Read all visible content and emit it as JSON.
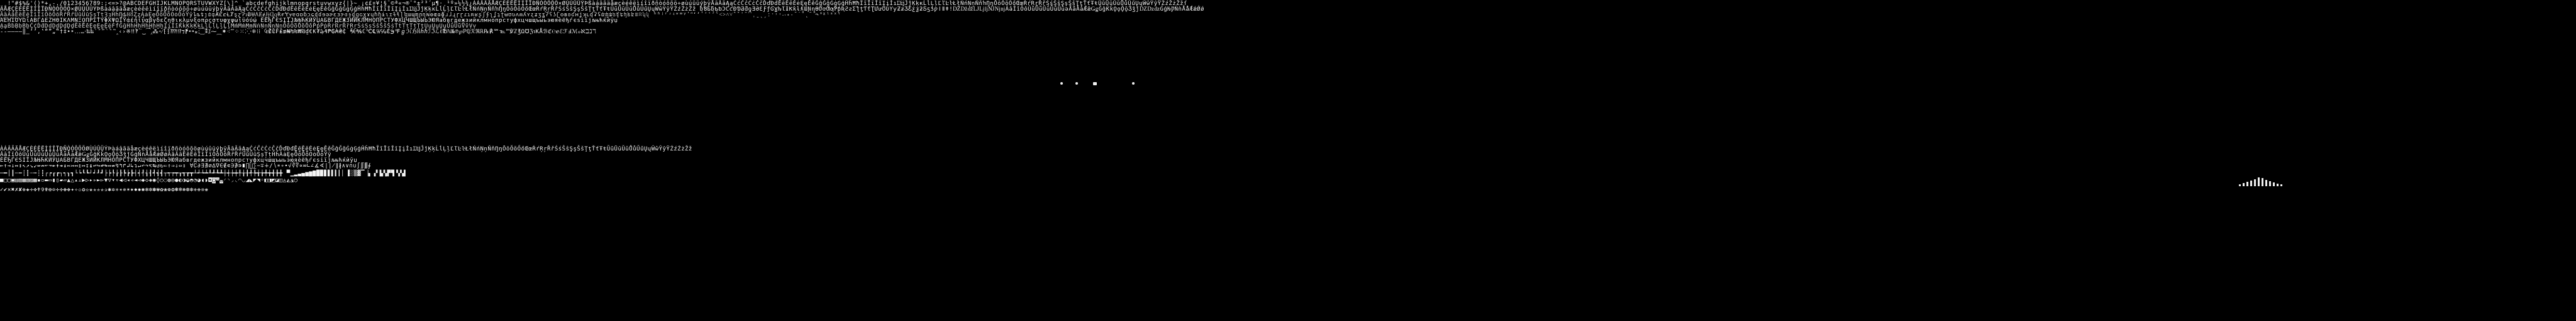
{
  "sheet": {
    "background": "#000000",
    "glyph_color": "#f4f4f4"
  },
  "top_rows": {
    "row1": "  !\"#$%&'()*+,-./0123456789:;<=>?@ABCDEFGHIJKLMNOPQRSTUVWXYZ[\\]^_`abcdefghijklmnopqrstuvwxyz{|}~ ¡¢£¤¥¦§¨©ª«¬®¯°±²³´µ¶·¸¹º»¼½¾¿ÀÁÂÃÄÅÆÇÈÉÊËÌÍÎÏÐÑÒÓÔÕÖ×ØÙÚÛÜÝÞßàáâãäåæçèéêëìíîïðñòóôõö÷øùúûüýþÿĀāĂăĄąĆćĈĉĊċČčĎďĐđĒēĔĕĖėĘęĚěĜĝĞğĠġĢģĤĥĦħĨĩĪīĬĭĮįİıĲĳĴĵĶķĸĹĺĻļĽľĿŀŁłŃńŅņŇňŉŊŋŌōŎŏŐőŒœŔŕŖŗŘřŚśŜŝŞşŠšŢţŤťŦŧŨũŪūŬŭŮůŰűŲųŴŵŶŷŸŹźŻżŽžſ",
    "row2": "ÄÅÆÇÈÉÊËÌÍÎÏÐÑÒÓÔÕÖ×ØÙÚÛÜÝÞßàáâãäåæçèéêëìíîïðñòóôõö÷øùúûüýþÿĀāĂăĄąĆćĈĉĊċČčĎďĐđĒēĔĕĖėĘęĚěĜĝĞğĠġĢģĤĥĦħĨĩĪīĬĭĮįİıĲĳĴĵĶķĸĹĺĻļĽľĿŀŁłŃńŅņŇňŉŊŋŌōŎŏŐőŒœŔŕŖŗŘřŚśŜŝŞşŠšŢţŤťŦŧŨũŪūŬŭŮůŰűŲųŴŵŶŷŸŹźŻżŽž ƀƁƂƃƄƅƆƇƈƉƊƋƌƍƎƏƐƑƒƓƔƕƖƗƘƙƚƛƜƝƞƟƠơƢƣƤƥƦƧƨƩƪƫƬƭƮƯưƱƲƳƴƵƶƷƸƹƺƻƼƽƾƿǀǁǂǃǄǅǆǇǈǉǊǋǌǍǎǏǐǑǒǓǔǕǖǗǘǙǚǛǜǝǞǟǠǡǢǣǤǥǦǧǨǩǪǫǬǭǮǯǰǱǲǳǴǵǶǷǸǹǺǻǼǽǾǿ",
    "row3": "ȀȁȂȃȄȅȆȇȈȉȊȋȌȍȎȏȐȑȒȓȔȕȖȗȘșȚțȜȝȞȟȠȡȢȣȤȥȦȧȨȩȪȫȬȭȮȯȰȱȲȳȴȵȶȷȸȹȺȻȼȽȾȿɀɁɂɃɄɅɆɇɈɉɊɋɌɍɎɏɐɑɒɓɔɕɖɗɘəɚɛɜɝɞɟɠɡɢɣɤɥɦɧɨɩɪɫɬɭɮɯɰɱɲɳɴɵɶɷɸɹɺɻɼɽɾɿʀʁʂʃʄʅʆʇʈʉʊʋʌʍʎʏʐʑʒʓʔʕʖʗʘʙʚʛʜʝʞʟʠʡʢʣʤʥʦʧʨʩʪʫʬʭʮʯ ʰʱʲʳʴʵʶʷʸʹʺʻʼʽʾʿˀˁ˂˃˄˅ˆˇˈˉˊˋˌˍˎˏːˑ˒˓˔˕˖˗˘˙˚˛˜˝˞˟ˠˡˢˣˤ",
    "row4": "ΆΈΉΊΌΎΏΐΑΒΓΔΕΖΗΘΙΚΛΜΝΞΟΠΡΣΤΥΦΧΨΩΪΫάέήίΰαβγδεζηθικλμνξοπρςστυφχψωϊϋόύώ ЀЁЂЃЄЅІЇЈЉЊЋЌЍЎЏАБВГДЕЖЗИЙКЛМНОПРСТУФХЦЧШЩЪЫЬЭЮЯабвгдежзийклмнопрстуфхцчшщъыьэюяѐёђѓєѕіїјљњћќѝўџ",
    "row5": "ḀḁḂḃḄḅḆḇḈḉḊḋḌḍḎḏḐḑḒḓḔḕḖḗḘḙḚḛḜḝḞḟḠḡḢḣḤḥḦḧḨḩḪḫḬḭḮḯḰḱḲḳḴḵḶḷḸḹḺḻḼḽḾḿṀṁṂṃṄṅṆṇṈṉṊṋṌṍṎṏṐṑṒṓṔṕṖṗṘṙṚṛṜṝṞṟṠṡṢṣṤṥṦṧṨṩṪṫṬṭṮṯṰṱṲṳṴṵṶṷṸṹṺṻṼṽṾṿ",
    "row6": "‐‑‒–—―‖‗‘’‚‛“”„‟†‡•‣․‥…‧‰‱′″‴‵‶‷‸‹›※‼‽‾‿⁀⁁⁂⁃⁄⁅⁆⁇⁈⁉⁊⁋⁌⁍⁎⁏⁐⁑⁒⁓⁔⁕⁖⁗⁘⁙⁚⁛⁜⁝⁞ ₠₡₢₣₤₥₦₧₨₩₪₫€₭₮₯₰₱₲₳₴₵ ℀℁ℂ℃℄℅℆ℇ℈℉ℊℋℌℍℎℏℐℑℒℓ℔ℕ№℗℘ℙℚℛℜℝ℞℟℠℡™℣ℤ℥Ω℧ℨ℩KÅℬℭ℮ℯℰℱℲℳℴℵℶℷℸ"
  },
  "mid_marks": {
    "d1": "·",
    "d2": "·",
    "d3": "▫",
    "d4": "·"
  },
  "bottom_rows": {
    "row1": "ÀÁÂÃÄÅÆÇÈÉÊËÌÍÎÏÐÑÒÓÔÕÖØÙÚÛÜÝÞàáâãäåæçèéêëìíîïðñòóôõöøùúûüýþÿĀāĂăĄąĆćĈĉĊċČčĎďĐđĒēĔĕĖėĘęĚěĜĝĞğĠġĢģĤĥĦħĨĩĪīĬĭĮįİıĲĳĴĵĶķĹĺĻļĽľĿŀŁłŃńŅņŇňŊŋŌōŎŏŐőŒœŔŕŖŗŘřŚśŜŝŞşŠšŢţŤťŦŧŨũŪūŬŭŮůŰűŲųŴŵŶŷŸŹźŻżŽž",
    "row2": "ǍǎǏǐǑǒǓǔǕǖǗǘǙǚǛǜǞǟǠǡǢǣǤǥǦǧǨǩǪǫǬǭǮǯǰǴǵǸǹǺǻǼǽǾǿȀȁȂȃȄȅȆȇȈȉȊȋȌȍȎȏȐȑȒȓȔȕȖȗȘșȚțȞȟȦȧȨȩȪȫȬȭȮȯȰȱȲȳ",
    "row3": "ЀЁЂЃЄЅІЇЈЉЊЋЌЍЎЏАБВГДЕЖЗИЙКЛМНОПРСТУФХЦЧШЩЪЫЬЭЮЯабвгдежзийклмнопрстуфхцчшщъыьэюяѐёђѓєѕіїјљњћќѝўџ",
    "row4": "←↑→↓↔↕↖↗↘↙↚↛↜↝↞↟↠↡↢↣↤↥↦↧↨↩↪↫↬↭↮↯↰↱↲↳↴↵↶↷↸↹↺↻⇐⇑⇒⇓⇔⇕ ∀∁∂∃∄∅∆∇∈∉∊∋∌∍∎∏∐∑−∓∔∕∖∗∘∙√∛∜∝∞∟∠∡∢∣∤∥∦∧∨∩∪∫∬∭∮",
    "row5": "─━│┃┄┅┆┇┈┉┊┋┌┍┎┏┐┑┒┓└┕┖┗┘┙┚┛├┝┞┟┠┡┢┣┤┥┦┧┨┩┪┫┬┭┮┯┰┱┲┳┴┵┶┷┸┹┺┻┼┽┾┿╀╁╂╃╄╅╆╇╈╉╊╋ ▀▁▂▃▄▅▆▇█▉▊▋▌▍▎▏▐░▒▓▔▕▖▗▘▙▚▛▜▝▞▟",
    "row6": "■□▢▣▤▥▦▧▨▩▪▫▬▭▮▯▰▱▲△▴▵▶▷▸▹►▻▼▽▾▿◀◁◂◃◄◅◆◇◈◉◊○◌◍◎●◐◑◒◓◔◕◖◗◘◙◚◛◜◝◞◟◠◡◢◣◤◥◦◧◨◩◪◫◬◭◮◯",
    "row7": "✓✔✕✖✗✘✙✚✛✜✝✞✟✠✡✢✣✤✥✦✧✩✪✫✬✭✮✯✰✱✲✳✴✵✶✷✸✹✺✻✼✽✾✿❀❁❂❃❄❅❆❇❈❉❊❋"
  },
  "bar_levels": [
    0.2,
    0.35,
    0.5,
    0.65,
    0.8,
    1.0,
    0.9,
    0.7,
    0.55,
    0.4,
    0.3,
    0.2
  ]
}
